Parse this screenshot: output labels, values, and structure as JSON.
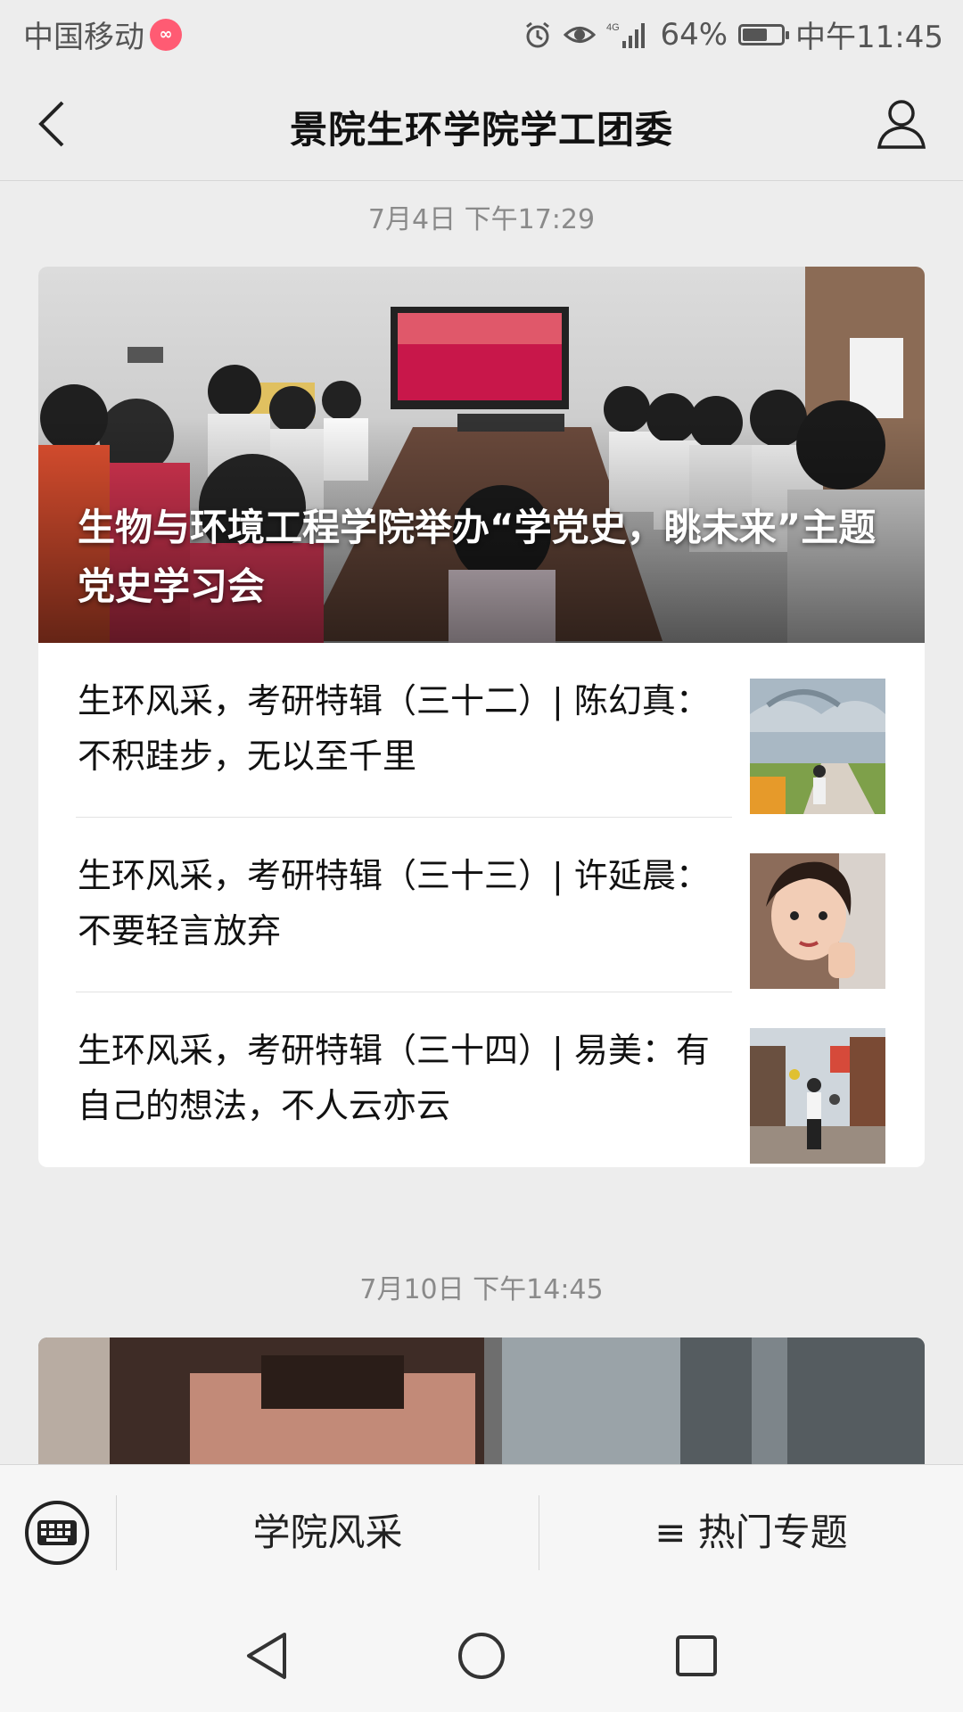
{
  "status_bar": {
    "carrier": "中国移动",
    "network": "4G",
    "battery": "64%",
    "battery_level": 0.64,
    "time": "中午11:45"
  },
  "header": {
    "title": "景院生环学院学工团委"
  },
  "feed": {
    "groups": [
      {
        "date": "7月4日 下午17:29",
        "cover_title": "生物与环境工程学院举办“学党史，眺未来”主题党史学习会",
        "items": [
          {
            "title": "生环风采，考研特辑（三十二）| 陈幻真：不积跬步，无以至千里"
          },
          {
            "title": "生环风采，考研特辑（三十三）| 许延晨：不要轻言放弃"
          },
          {
            "title": "生环风采，考研特辑（三十四）| 易美：有自己的想法，不人云亦云"
          }
        ]
      },
      {
        "date": "7月10日 下午14:45"
      }
    ]
  },
  "bottom_menu": {
    "item1": "学院风采",
    "item2": "≡ 热门专题"
  },
  "icons": {
    "back": "back-chevron-icon",
    "profile": "person-icon",
    "keyboard": "keyboard-icon",
    "nav_back": "triangle-back-icon",
    "nav_home": "circle-home-icon",
    "nav_recents": "square-recents-icon"
  },
  "colors": {
    "background": "#ededed",
    "card": "#ffffff",
    "date_text": "#8a8a8a"
  }
}
